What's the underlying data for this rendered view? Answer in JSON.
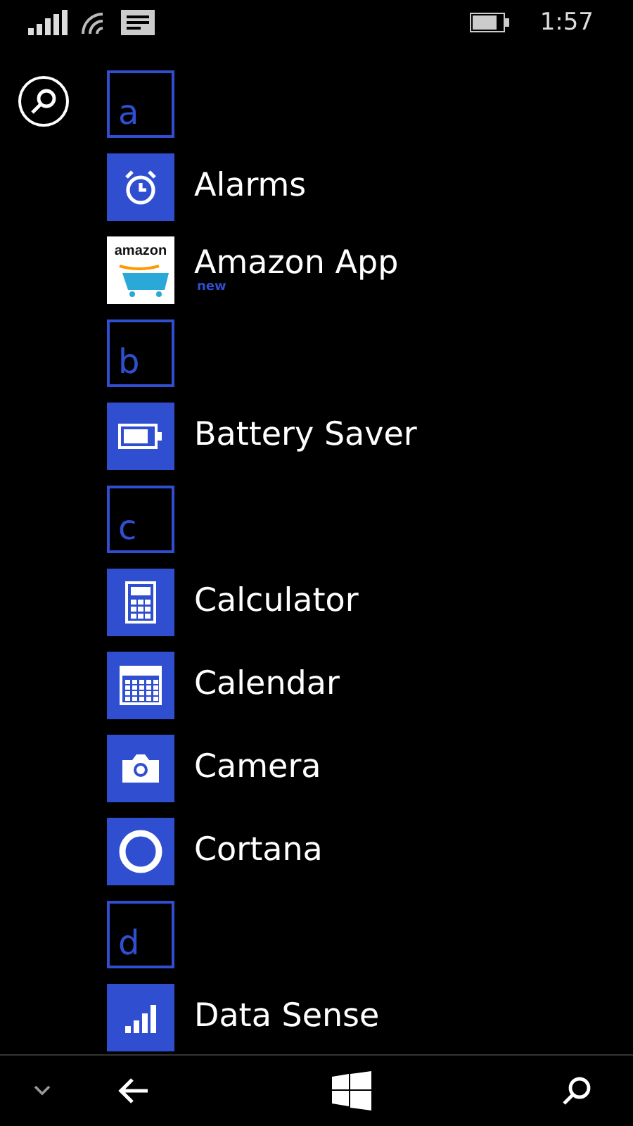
{
  "status_bar": {
    "time": "1:57"
  },
  "apps": [
    {
      "kind": "header",
      "label": "a"
    },
    {
      "kind": "app",
      "label": "Alarms"
    },
    {
      "kind": "app",
      "label": "Amazon App",
      "tile_text": "amazon",
      "badge": "new"
    },
    {
      "kind": "header",
      "label": "b"
    },
    {
      "kind": "app",
      "label": "Battery Saver"
    },
    {
      "kind": "header",
      "label": "c"
    },
    {
      "kind": "app",
      "label": "Calculator"
    },
    {
      "kind": "app",
      "label": "Calendar"
    },
    {
      "kind": "app",
      "label": "Camera"
    },
    {
      "kind": "app",
      "label": "Cortana"
    },
    {
      "kind": "header",
      "label": "d"
    },
    {
      "kind": "app",
      "label": "Data Sense"
    }
  ]
}
